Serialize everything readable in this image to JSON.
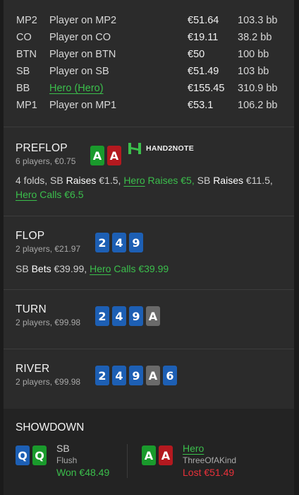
{
  "players": [
    {
      "pos": "MP2",
      "name": "Player on MP2",
      "stack": "€51.64",
      "bb": "103.3 bb",
      "hero": false
    },
    {
      "pos": "CO",
      "name": "Player on CO",
      "stack": "€19.11",
      "bb": "38.2 bb",
      "hero": false
    },
    {
      "pos": "BTN",
      "name": "Player on BTN",
      "stack": "€50",
      "bb": "100 bb",
      "hero": false
    },
    {
      "pos": "SB",
      "name": "Player on SB",
      "stack": "€51.49",
      "bb": "103 bb",
      "hero": false
    },
    {
      "pos": "BB",
      "name": "Hero (Hero)",
      "stack": "€155.45",
      "bb": "310.9 bb",
      "hero": true
    },
    {
      "pos": "MP1",
      "name": "Player on MP1",
      "stack": "€53.1",
      "bb": "106.2 bb",
      "hero": false
    }
  ],
  "logo_text": "HAND2NOTE",
  "preflop": {
    "title": "PREFLOP",
    "sub": "6 players, €0.75",
    "hero_cards": [
      {
        "rank": "A",
        "color": "green"
      },
      {
        "rank": "A",
        "color": "red"
      }
    ],
    "a1": "4 folds, SB ",
    "a2": "Raises",
    "a3": " €1.5, ",
    "a4": "Hero",
    "a5": " Raises €5,",
    "a6": " SB ",
    "a7": "Raises",
    "a8": " €11.5,",
    "a9": "Hero",
    "a10": " Calls €6.5"
  },
  "flop": {
    "title": "FLOP",
    "sub": "2 players, €21.97",
    "cards": [
      {
        "rank": "2",
        "color": "blue"
      },
      {
        "rank": "4",
        "color": "blue"
      },
      {
        "rank": "9",
        "color": "blue"
      }
    ],
    "a1": "SB ",
    "a2": "Bets",
    "a3": " €39.99, ",
    "a4": "Hero",
    "a5": " Calls €39.99"
  },
  "turn": {
    "title": "TURN",
    "sub": "2 players, €99.98",
    "cards": [
      {
        "rank": "2",
        "color": "blue"
      },
      {
        "rank": "4",
        "color": "blue"
      },
      {
        "rank": "9",
        "color": "blue"
      },
      {
        "rank": "A",
        "color": "gray"
      }
    ]
  },
  "river": {
    "title": "RIVER",
    "sub": "2 players, €99.98",
    "cards": [
      {
        "rank": "2",
        "color": "blue"
      },
      {
        "rank": "4",
        "color": "blue"
      },
      {
        "rank": "9",
        "color": "blue"
      },
      {
        "rank": "A",
        "color": "gray"
      },
      {
        "rank": "6",
        "color": "blue"
      }
    ]
  },
  "showdown": {
    "title": "SHOWDOWN",
    "left": {
      "cards": [
        {
          "rank": "Q",
          "color": "blue"
        },
        {
          "rank": "Q",
          "color": "green"
        }
      ],
      "name": "SB",
      "hand": "Flush",
      "result": "Won €48.49"
    },
    "right": {
      "cards": [
        {
          "rank": "A",
          "color": "green"
        },
        {
          "rank": "A",
          "color": "red"
        }
      ],
      "name": "Hero",
      "hand": "ThreeOfAKind",
      "result": "Lost €51.49"
    }
  }
}
